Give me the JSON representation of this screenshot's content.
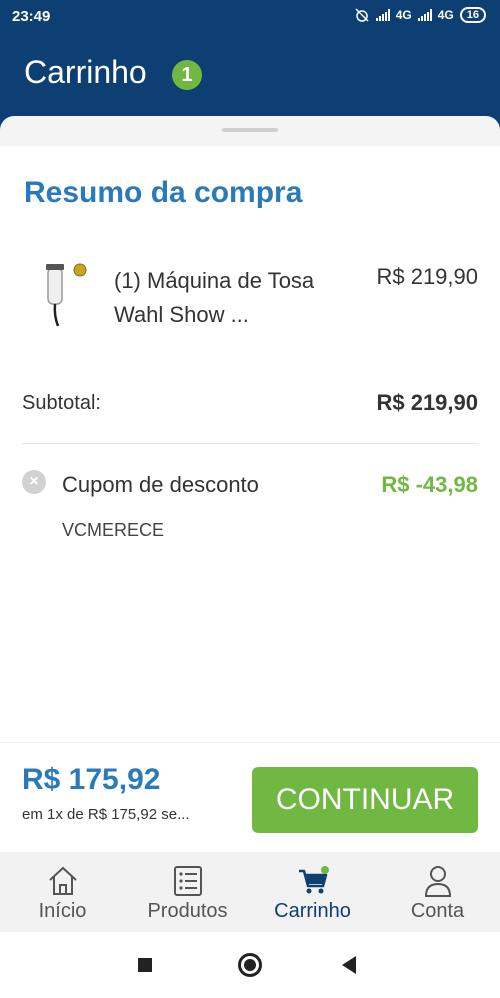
{
  "status_bar": {
    "time": "23:49",
    "network_1": "4G",
    "network_2": "4G",
    "battery": "16"
  },
  "app_bar": {
    "title": "Carrinho",
    "cart_count": "1"
  },
  "summary": {
    "title": "Resumo da compra",
    "product": {
      "name": "(1) Máquina de Tosa Wahl Show ...",
      "price": "R$ 219,90"
    },
    "subtotal_label": "Subtotal:",
    "subtotal_value": "R$ 219,90",
    "coupon": {
      "label": "Cupom de desconto",
      "value": "R$ -43,98",
      "code": "VCMERECE"
    }
  },
  "footer": {
    "total": "R$ 175,92",
    "installments": "em 1x de R$ 175,92 se...",
    "continue_label": "CONTINUAR"
  },
  "bottom_nav": {
    "items": [
      {
        "label": "Início",
        "icon": "home-icon"
      },
      {
        "label": "Produtos",
        "icon": "list-icon"
      },
      {
        "label": "Carrinho",
        "icon": "cart-icon",
        "active": true
      },
      {
        "label": "Conta",
        "icon": "user-icon"
      }
    ]
  },
  "colors": {
    "primary_dark": "#0e3f73",
    "accent_blue": "#2a79b8",
    "accent_green": "#71b843"
  }
}
